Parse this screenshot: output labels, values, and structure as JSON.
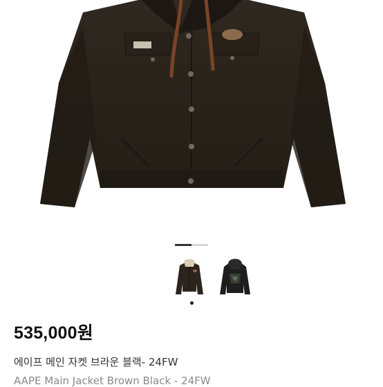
{
  "product": {
    "image_alt": "AAPE Main Jacket Brown Black",
    "price": "535,000원",
    "title": "에이프 메인 자켓 브라운 블랙- 24FW",
    "subtitle": "AAPE Main Jacket Brown Black - 24FW"
  },
  "gallery": {
    "total_images": 2,
    "active_index": 0
  },
  "colors": {
    "jacket": "#2b241c",
    "drawstring": "#7a4426",
    "pager_active": "#333333",
    "pager_inactive": "#d6d6d6"
  }
}
